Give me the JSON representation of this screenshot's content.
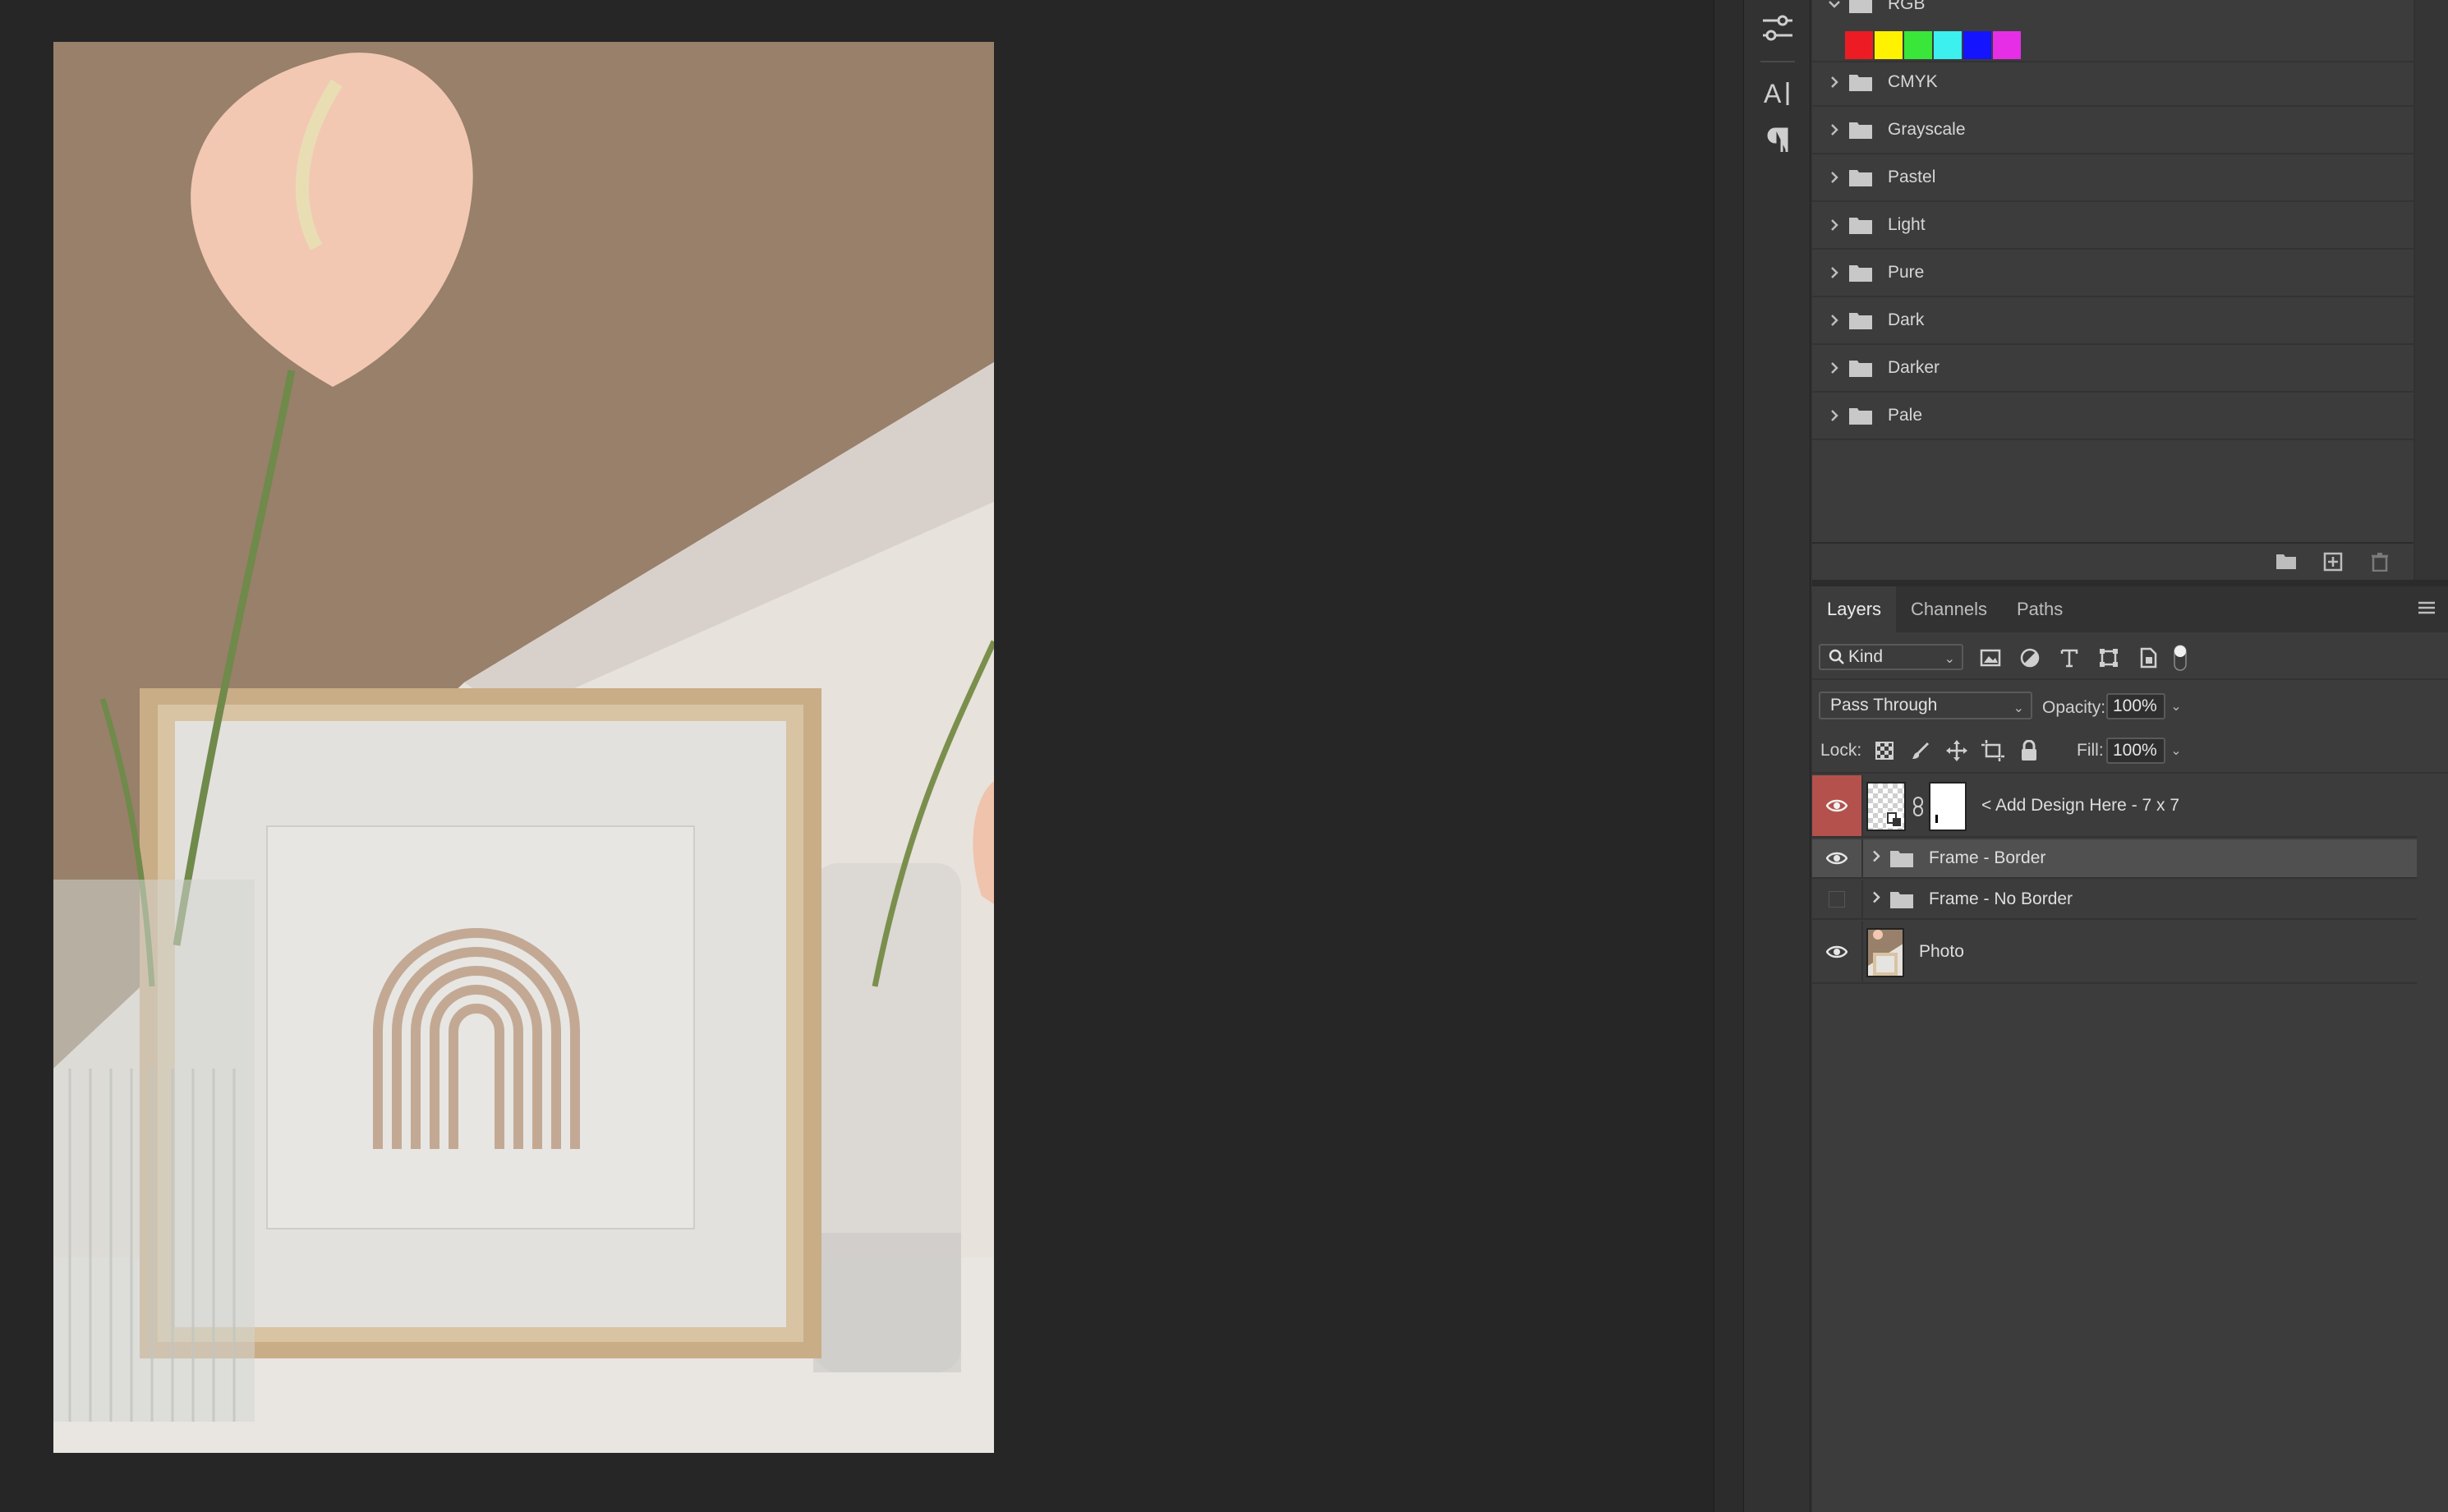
{
  "swatches_panel": {
    "groups": [
      {
        "label": "RGB",
        "expanded": true
      },
      {
        "label": "CMYK"
      },
      {
        "label": "Grayscale"
      },
      {
        "label": "Pastel"
      },
      {
        "label": "Light"
      },
      {
        "label": "Pure"
      },
      {
        "label": "Dark"
      },
      {
        "label": "Darker"
      },
      {
        "label": "Pale"
      }
    ],
    "rgb_colors": [
      "#ed1c24",
      "#fff200",
      "#39e639",
      "#3cf0f0",
      "#1414ff",
      "#e62ee6"
    ]
  },
  "layers_panel": {
    "tabs": [
      "Layers",
      "Channels",
      "Paths"
    ],
    "active_tab": "Layers",
    "filter_kind": "Kind",
    "blend_mode": "Pass Through",
    "opacity_label": "Opacity:",
    "opacity_value": "100%",
    "lock_label": "Lock:",
    "fill_label": "Fill:",
    "fill_value": "100%",
    "layers": [
      {
        "name": "< Add Design Here - 7 x 7",
        "visible": true,
        "type": "smart-object"
      },
      {
        "name": "Frame - Border",
        "visible": true,
        "type": "group",
        "selected": true
      },
      {
        "name": "Frame - No Border",
        "visible": false,
        "type": "group"
      },
      {
        "name": "Photo",
        "visible": true,
        "type": "image"
      }
    ]
  },
  "colors": {
    "accent_eye_bg": "#b4514c",
    "selected_layer_bg": "#505050"
  }
}
